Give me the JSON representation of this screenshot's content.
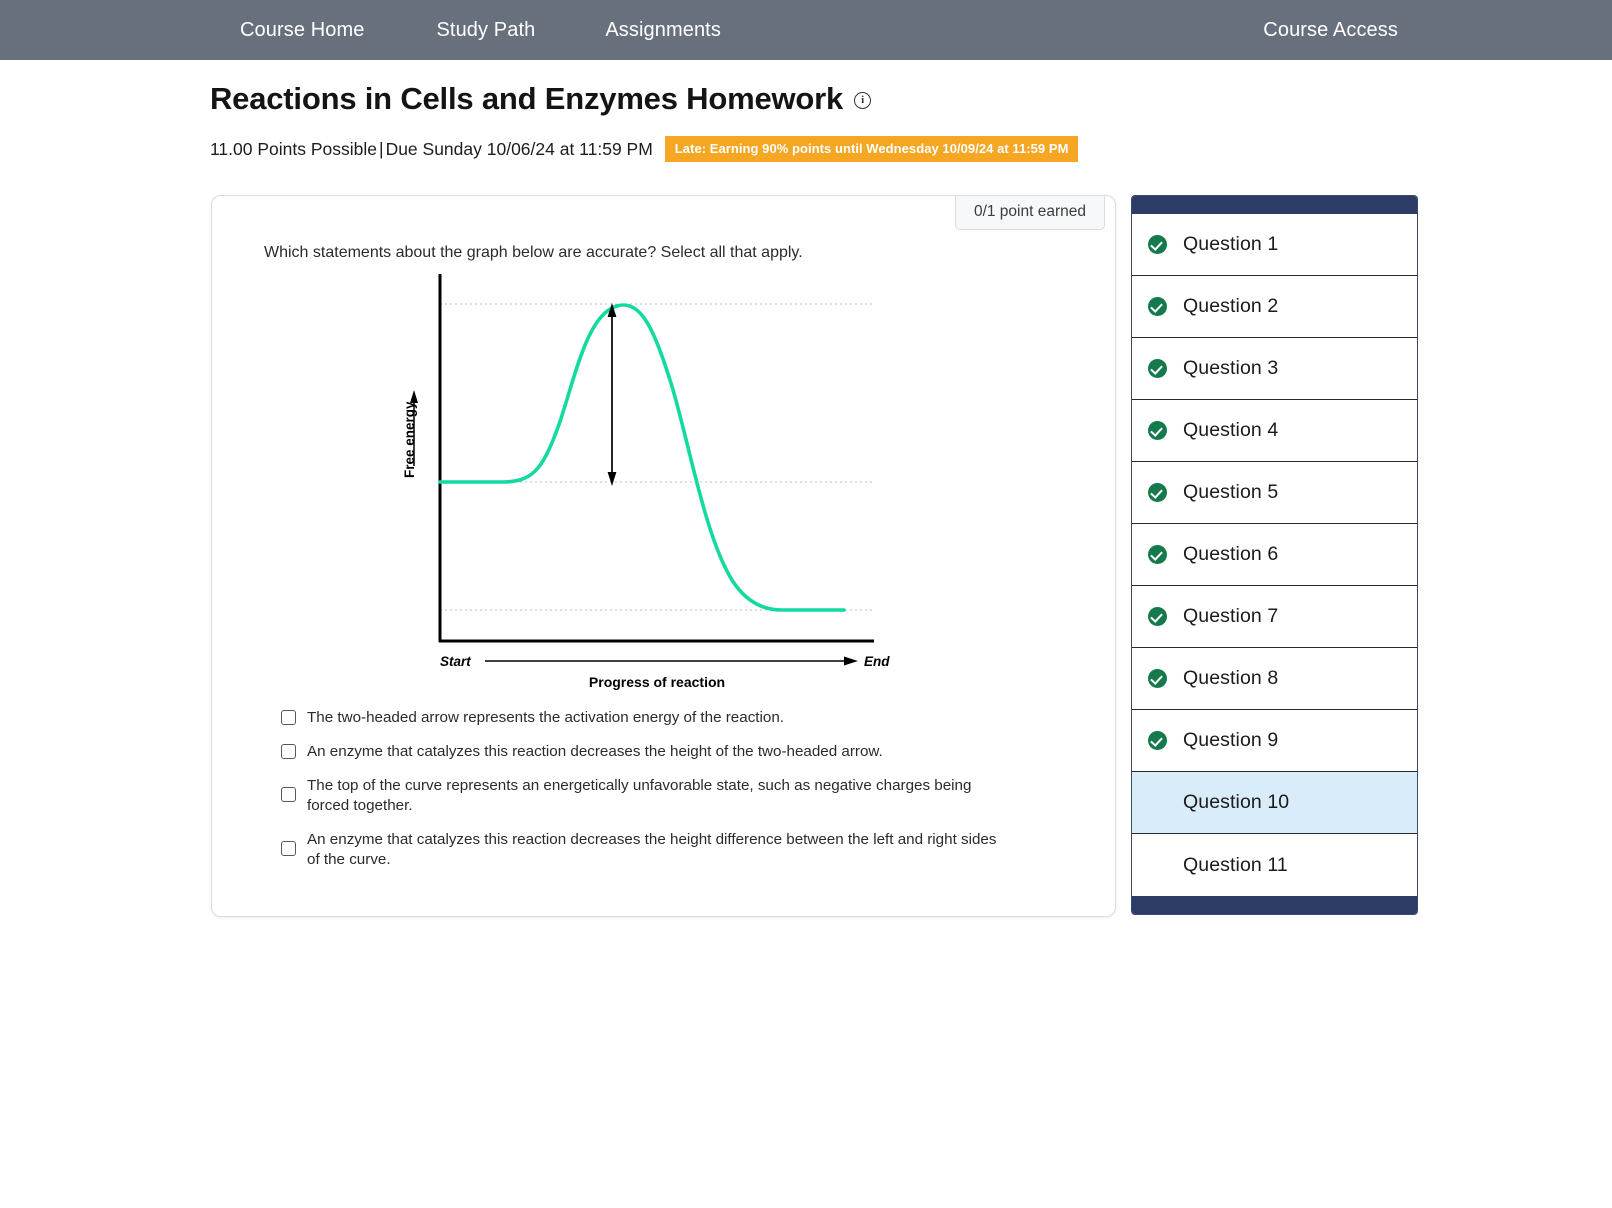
{
  "topnav": {
    "items": [
      {
        "label": "Course Home",
        "name": "nav-course-home"
      },
      {
        "label": "Study Path",
        "name": "nav-study-path"
      },
      {
        "label": "Assignments",
        "name": "nav-assignments"
      }
    ],
    "right_label": "Course Access",
    "background": "#67707c"
  },
  "header": {
    "title": "Reactions in Cells and Enzymes Homework",
    "info_icon": "info-circle-icon",
    "points_possible": "11.00 Points Possible",
    "separator": "|",
    "due": "Due Sunday 10/06/24 at 11:59 PM",
    "late_badge": "Late: Earning 90% points until Wednesday 10/09/24 at 11:59 PM",
    "late_badge_color": "#f5a623"
  },
  "question": {
    "points_badge": "0/1 point earned",
    "prompt": "Which statements about the graph below are accurate? Select all that apply.",
    "options": [
      {
        "label": "The two-headed arrow represents the activation energy of the reaction.",
        "checked": false
      },
      {
        "label": "An enzyme that catalyzes this reaction decreases the height of the two-headed arrow.",
        "checked": false
      },
      {
        "label": "The top of the curve represents an energetically unfavorable state, such as negative charges being forced together.",
        "checked": false
      },
      {
        "label": "An enzyme that catalyzes this reaction decreases the height difference between the left and right sides of the curve.",
        "checked": false
      }
    ]
  },
  "chart_data": {
    "type": "line",
    "title": "",
    "xlabel": "Progress of reaction",
    "ylabel": "Free energy",
    "x_start_label": "Start",
    "x_end_label": "End",
    "curve_color": "#14d9a0",
    "axis_color": "#000000",
    "gridline_color": "#bfbfbf",
    "annotation": "two-headed arrow spanning from reactant level to transition state peak (activation energy)",
    "levels": {
      "reactant_free_energy": 55,
      "transition_state_peak": 95,
      "product_free_energy": 12
    },
    "gridlines_y": [
      95,
      55,
      12
    ],
    "x": [
      0,
      5,
      10,
      14,
      18,
      22,
      26,
      30,
      34,
      38,
      42,
      46,
      50,
      54,
      58,
      62,
      66,
      70,
      74,
      78,
      82,
      86,
      90,
      95,
      100
    ],
    "y": [
      55,
      55,
      55,
      55.3,
      56.5,
      59.5,
      65,
      72.5,
      81,
      88.5,
      93.3,
      95,
      94.6,
      92,
      86.5,
      78,
      66.5,
      53,
      39,
      26.5,
      18,
      13.6,
      12.2,
      12,
      12
    ],
    "ylim": [
      0,
      100
    ],
    "xlim": [
      0,
      100
    ],
    "grid": true,
    "legend": null
  },
  "qnav": {
    "cap_color": "#2d3c66",
    "active_color": "#d9ecfa",
    "check_color": "#147a4b",
    "items": [
      {
        "label": "Question 1",
        "answered": true,
        "active": false
      },
      {
        "label": "Question 2",
        "answered": true,
        "active": false
      },
      {
        "label": "Question 3",
        "answered": true,
        "active": false
      },
      {
        "label": "Question 4",
        "answered": true,
        "active": false
      },
      {
        "label": "Question 5",
        "answered": true,
        "active": false
      },
      {
        "label": "Question 6",
        "answered": true,
        "active": false
      },
      {
        "label": "Question 7",
        "answered": true,
        "active": false
      },
      {
        "label": "Question 8",
        "answered": true,
        "active": false
      },
      {
        "label": "Question 9",
        "answered": true,
        "active": false
      },
      {
        "label": "Question 10",
        "answered": false,
        "active": true
      },
      {
        "label": "Question 11",
        "answered": false,
        "active": false
      }
    ]
  }
}
